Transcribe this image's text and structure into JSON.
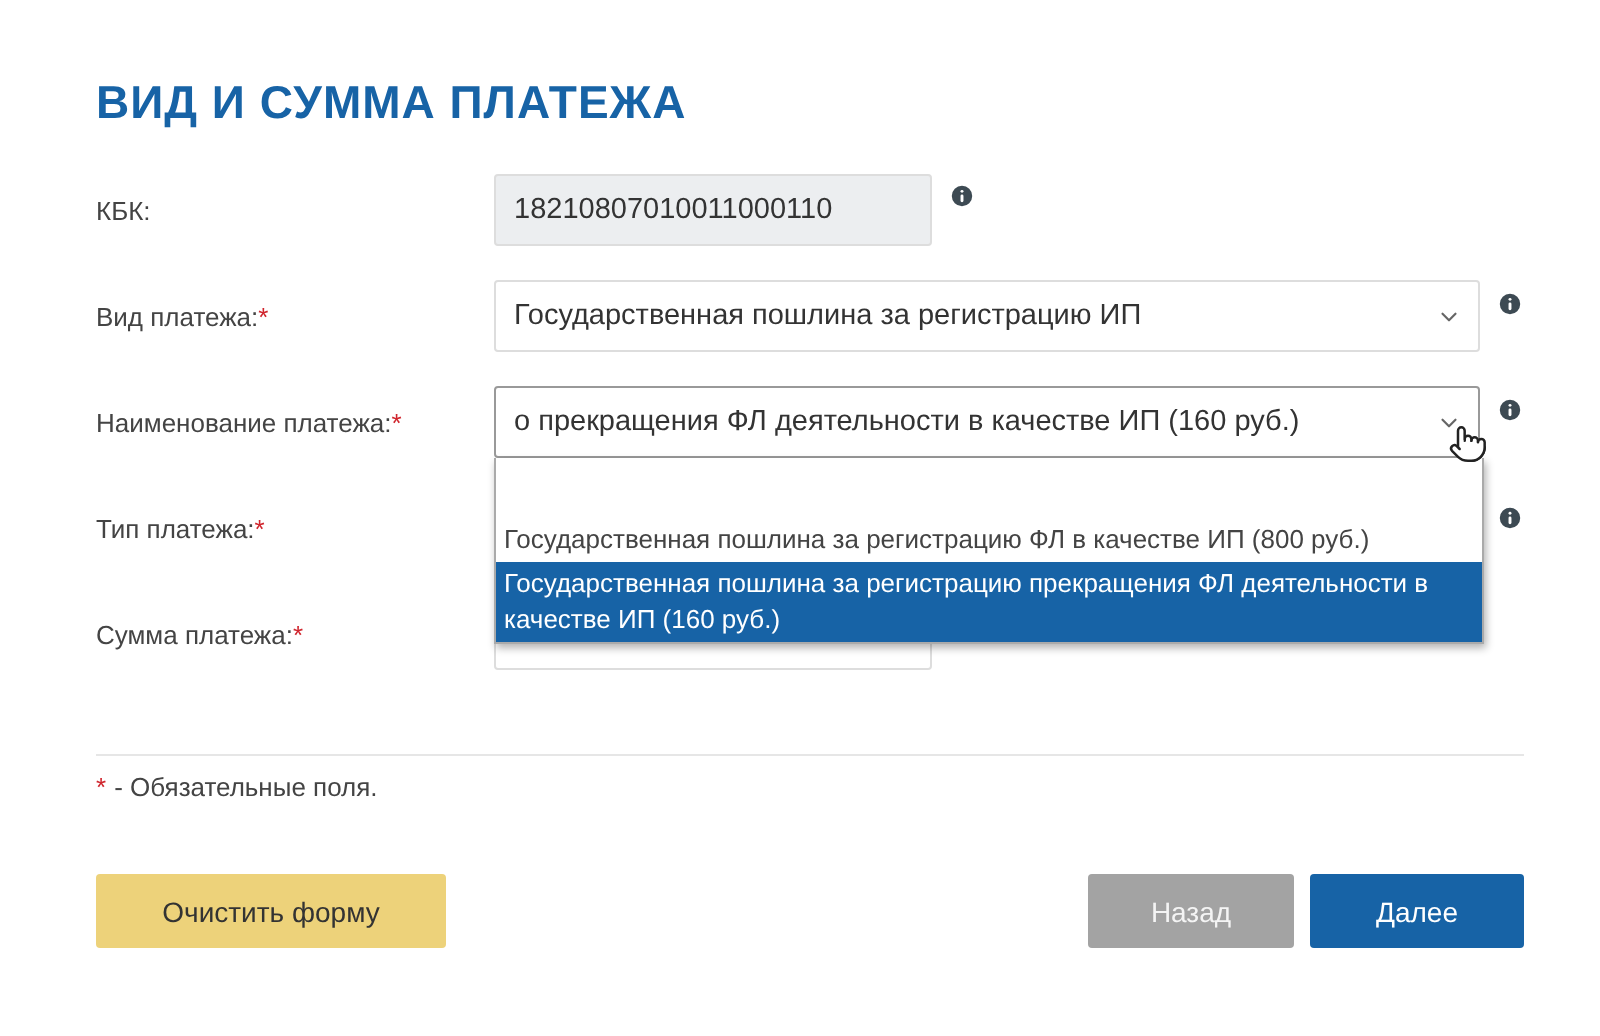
{
  "section_title": "ВИД И СУММА ПЛАТЕЖА",
  "fields": [
    {
      "kind": "readonly",
      "label": "КБК:",
      "required": false,
      "value": "18210807010011000110",
      "info": true
    },
    {
      "kind": "select",
      "label": "Вид платежа:",
      "required": true,
      "value": "Государственная пошлина за регистрацию ИП",
      "info": true,
      "expanded": false
    },
    {
      "kind": "select",
      "label": "Наименование платежа:",
      "required": true,
      "value": "о прекращения ФЛ деятельности в качестве ИП (160 руб.)",
      "info": true,
      "expanded": true,
      "options": [
        {
          "label": "Государственная пошлина за регистрацию ФЛ в качестве ИП (800 руб.)",
          "selected": false
        },
        {
          "label": "Государственная пошлина за регистрацию прекращения ФЛ деятельности в качестве ИП (160 руб.)",
          "selected": true
        }
      ]
    },
    {
      "kind": "hidden",
      "label": "Тип платежа:",
      "required": true,
      "info": true
    },
    {
      "kind": "amount",
      "label": "Сумма платежа:",
      "required": true,
      "info": false
    }
  ],
  "required_mark": "*",
  "required_note": "- Обязательные поля.",
  "buttons": [
    {
      "label": "Очистить форму",
      "kind": "clear",
      "disabled": false
    },
    {
      "label": "Назад",
      "kind": "back",
      "disabled": true
    },
    {
      "label": "Далее",
      "kind": "next",
      "disabled": false
    }
  ]
}
